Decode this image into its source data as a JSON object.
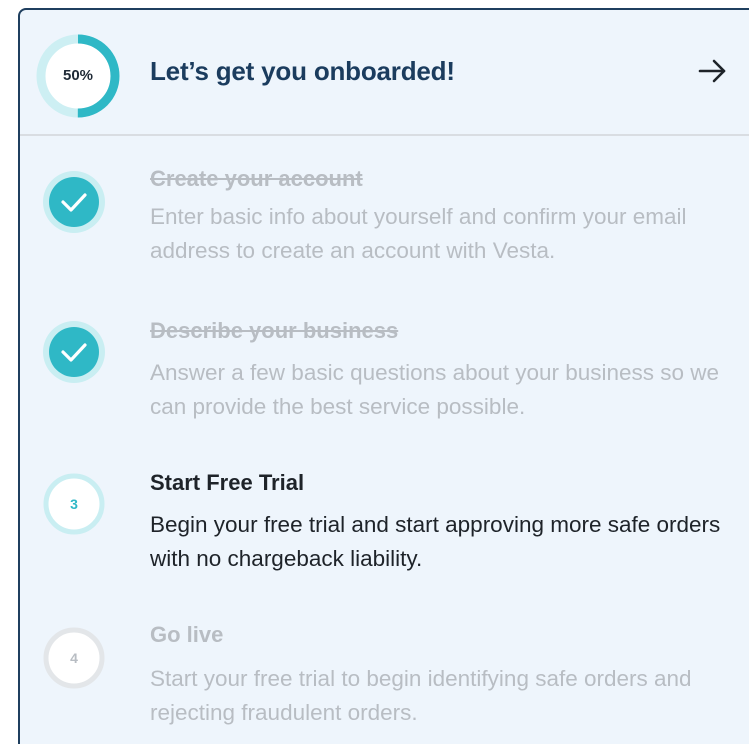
{
  "header": {
    "progress_label": "50%",
    "progress_fraction": 0.5,
    "title": "Let’s get you onboarded!",
    "arrow_icon": "arrow-right-icon"
  },
  "colors": {
    "accent": "#2fb8c6",
    "accent_light": "#c9eef2",
    "title": "#1b3c5e",
    "muted": "#b8bdc3",
    "panel_bg": "#eef5fc"
  },
  "steps": [
    {
      "state": "done",
      "icon": "check-icon",
      "title": "Create your account",
      "description": "Enter basic info about yourself and confirm your email address to create an account with Vesta."
    },
    {
      "state": "done",
      "icon": "check-icon",
      "title": "Describe your business",
      "description": "Answer a few basic questions about your business so we can provide the best service possible."
    },
    {
      "state": "active",
      "number": "3",
      "title": "Start Free Trial",
      "description": "Begin your free trial and start approving more safe orders with no chargeback liability."
    },
    {
      "state": "pending",
      "number": "4",
      "title": "Go live",
      "description": "Start your free trial to begin identifying safe orders and rejecting fraudulent orders."
    }
  ]
}
